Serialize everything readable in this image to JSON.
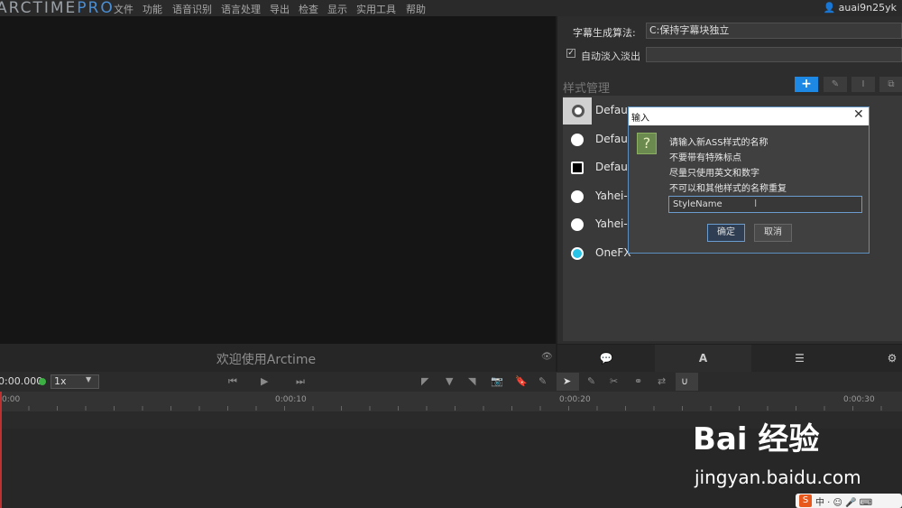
{
  "app": {
    "logo_main": "ARCTIME",
    "logo_pro": "PRO",
    "username": "auai9n25yk"
  },
  "menu": [
    "文件",
    "功能",
    "语音识别",
    "语言处理",
    "导出",
    "检查",
    "显示",
    "实用工具",
    "帮助"
  ],
  "settings": {
    "algo_label": "字幕生成算法:",
    "algo_value": "C:保持字幕块独立",
    "fade_label": "自动淡入淡出",
    "fade_checked": true
  },
  "style_manager": {
    "title": "样式管理",
    "toolbar": [
      "+",
      "✎",
      "I",
      "⧉"
    ],
    "styles": [
      "Defau",
      "Defau",
      "Defau",
      "Yahei-",
      "Yahei-",
      "OneFX"
    ]
  },
  "video": {
    "welcome": "欢迎使用Arctime"
  },
  "transport": {
    "timecode": "0:00.000",
    "speed": "1x"
  },
  "timeline": {
    "ticks": [
      "0:00",
      "0:00:10",
      "0:00:20",
      "0:00:30"
    ]
  },
  "dialog": {
    "title": "输入",
    "lines": [
      "请输入新ASS样式的名称",
      "不要带有特殊标点",
      "尽量只使用英文和数字",
      "不可以和其他样式的名称重复"
    ],
    "input_value": "StyleName",
    "ok": "确定",
    "cancel": "取消"
  },
  "watermark": {
    "logo": "Bai 经验",
    "url": "jingyan.baidu.com"
  },
  "ime": {
    "text": "中 · ☺ 🎤 ⌨"
  },
  "colors": {
    "accent": "#1e88e5",
    "dialog_border": "#5a8fc0",
    "status_ok": "#3cb043",
    "onefx": "#29c3e8"
  }
}
